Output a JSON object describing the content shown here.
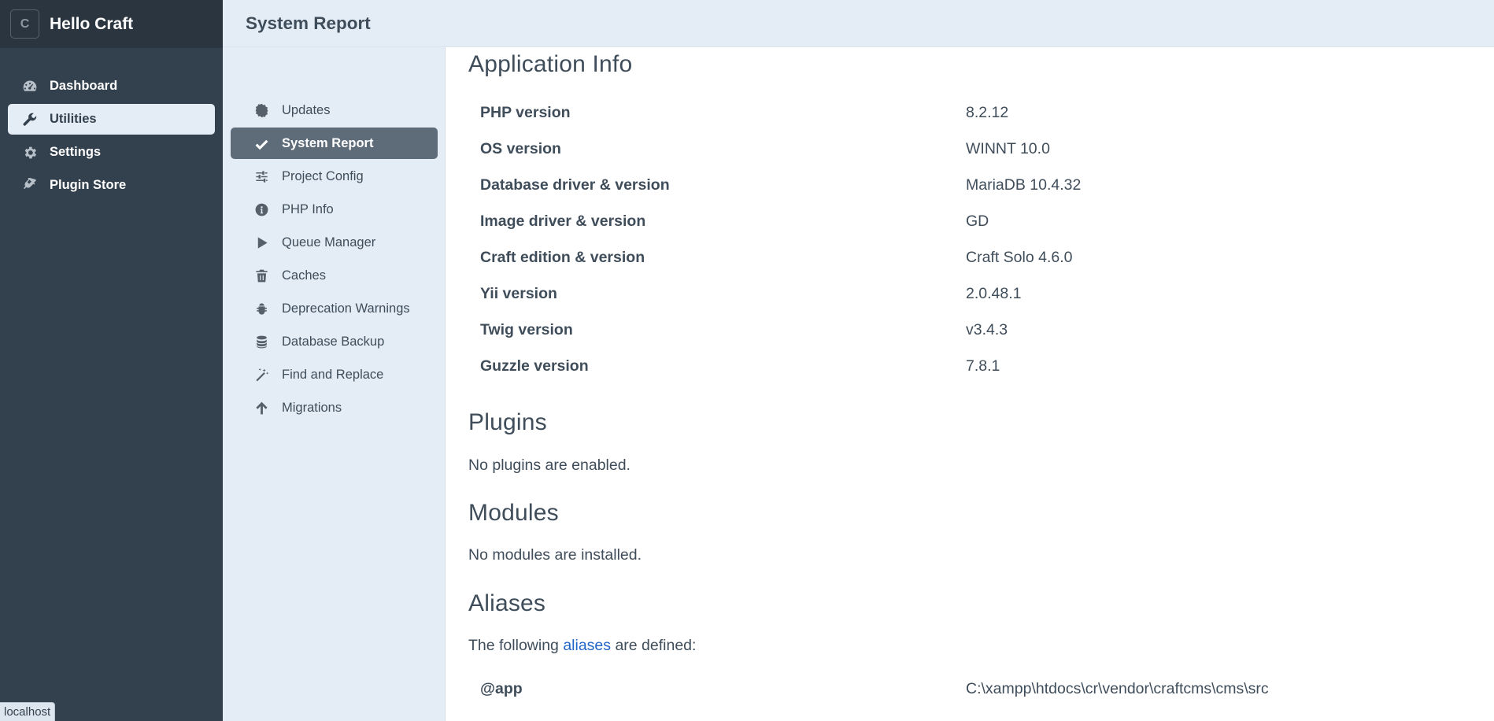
{
  "site": {
    "icon_letter": "C",
    "name": "Hello Craft"
  },
  "global_nav": {
    "items": [
      {
        "label": "Dashboard",
        "icon": "gauge-icon",
        "active": false
      },
      {
        "label": "Utilities",
        "icon": "wrench-icon",
        "active": true
      },
      {
        "label": "Settings",
        "icon": "gear-icon",
        "active": false
      },
      {
        "label": "Plugin Store",
        "icon": "plug-icon",
        "active": false
      }
    ]
  },
  "header": {
    "title": "System Report"
  },
  "utility_nav": {
    "items": [
      {
        "label": "Updates",
        "icon": "badge-icon"
      },
      {
        "label": "System Report",
        "icon": "check-icon",
        "active": true
      },
      {
        "label": "Project Config",
        "icon": "sliders-icon"
      },
      {
        "label": "PHP Info",
        "icon": "info-icon"
      },
      {
        "label": "Queue Manager",
        "icon": "play-icon"
      },
      {
        "label": "Caches",
        "icon": "trash-icon"
      },
      {
        "label": "Deprecation Warnings",
        "icon": "bug-icon"
      },
      {
        "label": "Database Backup",
        "icon": "database-icon"
      },
      {
        "label": "Find and Replace",
        "icon": "magic-wand-icon"
      },
      {
        "label": "Migrations",
        "icon": "arrow-up-icon"
      }
    ]
  },
  "content": {
    "app_info": {
      "heading": "Application Info",
      "rows": [
        {
          "label": "PHP version",
          "value": "8.2.12"
        },
        {
          "label": "OS version",
          "value": "WINNT 10.0"
        },
        {
          "label": "Database driver & version",
          "value": "MariaDB 10.4.32"
        },
        {
          "label": "Image driver & version",
          "value": "GD"
        },
        {
          "label": "Craft edition & version",
          "value": "Craft Solo 4.6.0"
        },
        {
          "label": "Yii version",
          "value": "2.0.48.1"
        },
        {
          "label": "Twig version",
          "value": "v3.4.3"
        },
        {
          "label": "Guzzle version",
          "value": "7.8.1"
        }
      ]
    },
    "plugins": {
      "heading": "Plugins",
      "text": "No plugins are enabled."
    },
    "modules": {
      "heading": "Modules",
      "text": "No modules are installed."
    },
    "aliases": {
      "heading": "Aliases",
      "intro_before": "The following ",
      "intro_link": "aliases",
      "intro_after": " are defined:",
      "rows": [
        {
          "label": "@app",
          "value": "C:\\xampp\\htdocs\\cr\\vendor\\craftcms\\cms\\src"
        }
      ]
    }
  },
  "status_bar": {
    "text": "localhost"
  }
}
